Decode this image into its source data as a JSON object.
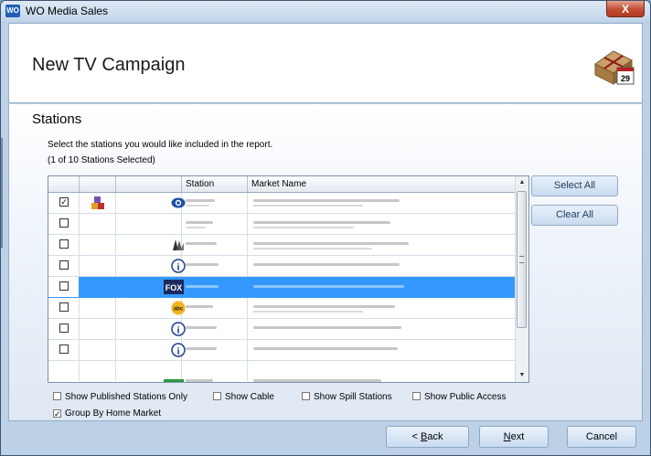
{
  "window": {
    "title": "WO Media Sales",
    "icon": "WO",
    "close": "X"
  },
  "header": {
    "title": "New TV Campaign",
    "calendar_day": "29"
  },
  "section": {
    "title": "Stations",
    "instructions": "Select the stations you would like included in the report.",
    "selected_count": "(1 of 10 Stations Selected)"
  },
  "grid": {
    "columns": [
      "",
      "",
      "",
      "Station",
      "Market Name"
    ],
    "rows": [
      {
        "checked": true,
        "group_icon": "cubes-icon",
        "logo": "cbs-eye-logo",
        "selected": false
      },
      {
        "checked": false,
        "group_icon": "",
        "logo": "",
        "selected": false
      },
      {
        "checked": false,
        "group_icon": "",
        "logo": "peacock-logo",
        "selected": false
      },
      {
        "checked": false,
        "group_icon": "",
        "logo": "info-logo",
        "selected": false
      },
      {
        "checked": false,
        "group_icon": "",
        "logo": "fox-logo",
        "selected": true
      },
      {
        "checked": false,
        "group_icon": "",
        "logo": "abc-logo",
        "selected": false
      },
      {
        "checked": false,
        "group_icon": "",
        "logo": "info-logo",
        "selected": false
      },
      {
        "checked": false,
        "group_icon": "",
        "logo": "info-logo",
        "selected": false
      }
    ],
    "logo_text": {
      "fox": "FOX",
      "abc": "abc",
      "info": "i"
    }
  },
  "buttons": {
    "select_all": "Select All",
    "clear_all": "Clear All"
  },
  "options": {
    "published_only": {
      "label": "Show Published Stations Only",
      "checked": false
    },
    "cable": {
      "label": "Show Cable",
      "checked": false
    },
    "spill": {
      "label": "Show Spill Stations",
      "checked": false
    },
    "public_access": {
      "label": "Show Public Access",
      "checked": false
    },
    "group_by_market": {
      "label": "Group By Home Market",
      "checked": true
    }
  },
  "footer": {
    "back_prefix": "< ",
    "back_mnemonic": "B",
    "back_rest": "ack",
    "next_mnemonic": "N",
    "next_rest": "ext",
    "cancel": "Cancel"
  },
  "colors": {
    "selection": "#3399ff",
    "chrome": "#bcd0e6"
  }
}
